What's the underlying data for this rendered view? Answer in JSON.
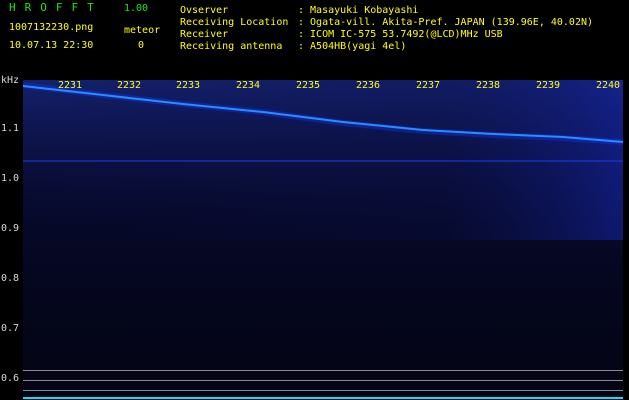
{
  "header": {
    "app_title": "HROFFT",
    "app_version": "1.00",
    "file_name": "1007132230.png",
    "mode_label": "meteor",
    "timestamp": "10.07.13 22:30",
    "meteor_count": "0",
    "fields": [
      {
        "label": "Ovserver",
        "value": ": Masayuki Kobayashi"
      },
      {
        "label": "Receiving Location",
        "value": ": Ogata-vill. Akita-Pref. JAPAN (139.96E, 40.02N)"
      },
      {
        "label": "Receiver",
        "value": ": ICOM IC-575 53.7492(@LCD)MHz USB"
      },
      {
        "label": "Receiving antenna",
        "value": ": A504HB(yagi 4el)"
      }
    ]
  },
  "spectrogram": {
    "unit": "kHz",
    "freq_ticks": [
      "1.1",
      "1.0",
      "0.9",
      "0.8",
      "0.7",
      "0.6"
    ],
    "time_ticks": [
      "2231",
      "2232",
      "2233",
      "2234",
      "2235",
      "2236",
      "2237",
      "2238",
      "2239",
      "2240"
    ],
    "trace_color": "#2c8cff",
    "background_color": "#030312",
    "label_color": "#ffff14"
  }
}
